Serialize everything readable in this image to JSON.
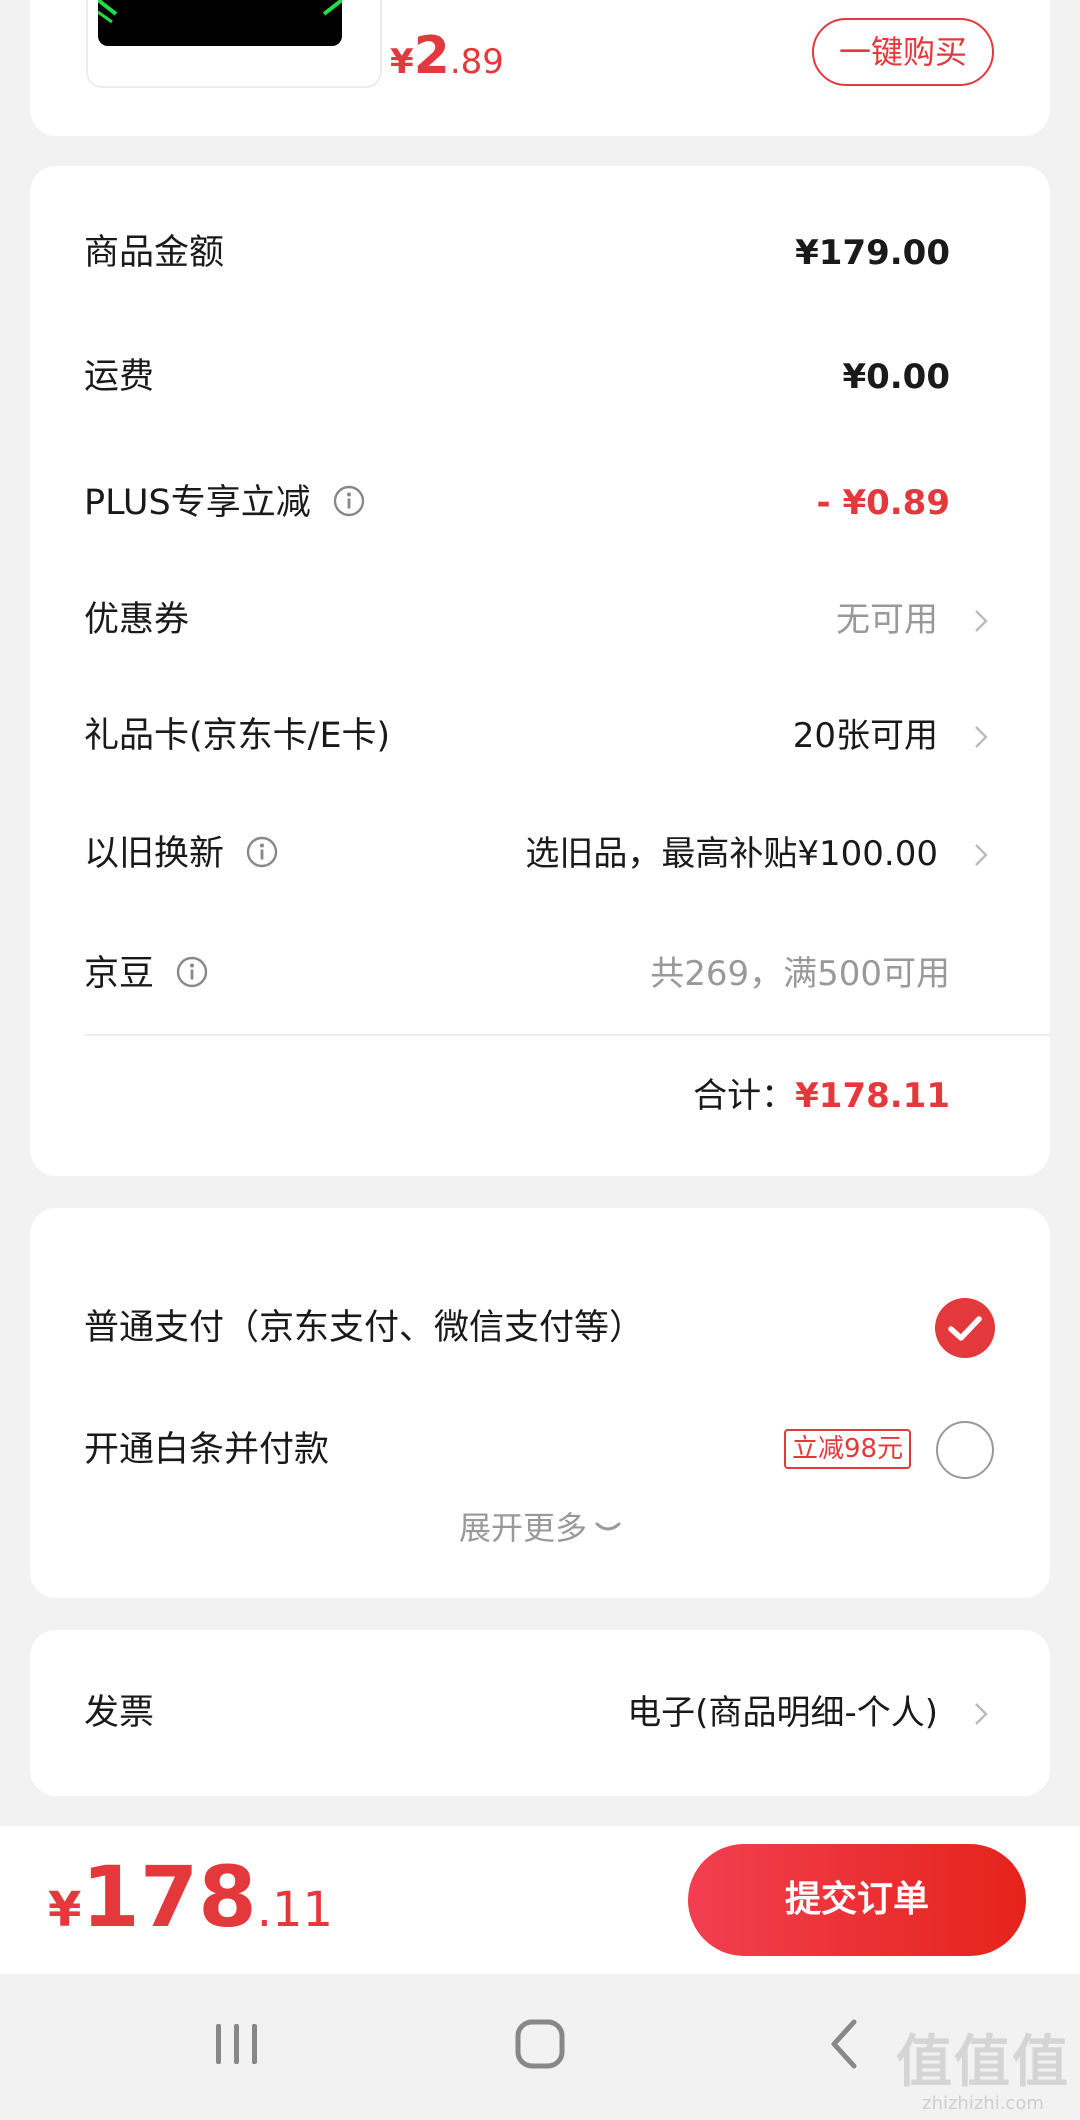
{
  "top_item": {
    "price_currency": "¥",
    "price_int": "2",
    "price_dec": ".89",
    "buy_button": "一键购买"
  },
  "summary": {
    "rows": [
      {
        "label": "商品金额",
        "value": "¥179.00"
      },
      {
        "label": "运费",
        "value": "¥0.00"
      },
      {
        "label": "PLUS专享立减",
        "value": "- ¥0.89"
      },
      {
        "label": "优惠券",
        "value": "无可用"
      },
      {
        "label": "礼品卡(京东卡/E卡)",
        "value": "20张可用"
      },
      {
        "label": "以旧换新",
        "value": "选旧品，最高补贴¥100.00"
      },
      {
        "label": "京豆",
        "value": "共269，满500可用"
      }
    ],
    "total_label": "合计：",
    "total_value": "¥178.11"
  },
  "payment": {
    "option_normal": "普通支付（京东支付、微信支付等）",
    "option_baitiao": "开通白条并付款",
    "baitiao_promo": "立减98元",
    "expand_more": "展开更多"
  },
  "invoice": {
    "label": "发票",
    "value": "电子(商品明细-个人)"
  },
  "bottom": {
    "currency": "¥",
    "price_int": "178",
    "price_dec": ".11",
    "submit_button": "提交订单"
  },
  "watermark": {
    "big": "值值值",
    "small": "zhizhizhi.com"
  },
  "colors": {
    "accent": "#e4393c",
    "background": "#f2f2f2"
  }
}
